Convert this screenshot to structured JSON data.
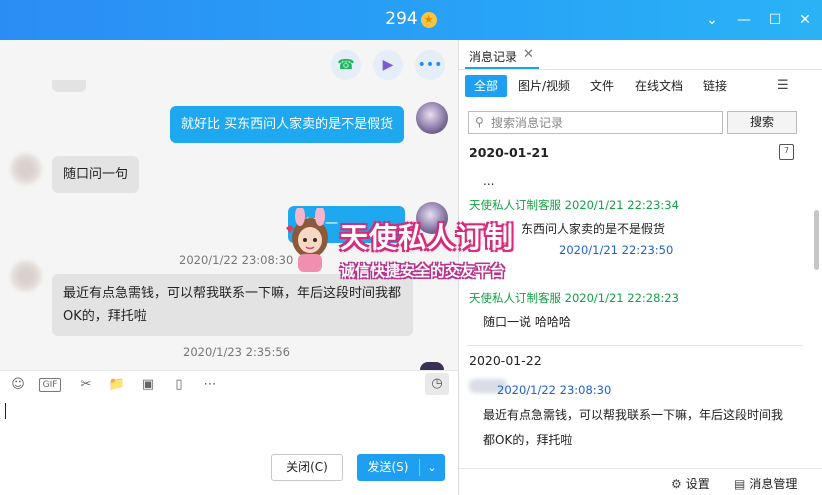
{
  "window": {
    "title": "294",
    "star_glyph": "★"
  },
  "chat": {
    "messages": [
      {
        "from": "me",
        "text": "就好比 买东西问人家卖的是不是假货"
      },
      {
        "from": "other",
        "text": "随口问一句"
      },
      {
        "from": "me",
        "text": "随口一"
      },
      {
        "timestamp": "2020/1/22 23:08:30"
      },
      {
        "from": "other",
        "lines": [
          "最近有点急需钱，可以帮我联系一下嘛，年后这段时间我都",
          "OK的，拜托啦"
        ]
      },
      {
        "timestamp": "2020/1/23 2:35:56"
      }
    ]
  },
  "composer": {
    "close_label": "关闭(C)",
    "send_label": "发送(S)"
  },
  "history": {
    "tab_label": "消息记录",
    "filters": [
      "全部",
      "图片/视频",
      "文件",
      "在线文档",
      "链接"
    ],
    "search_placeholder": "搜索消息记录",
    "search_button": "搜索",
    "groups": [
      {
        "date": "2020-01-21",
        "entries": [
          {
            "text": "..."
          },
          {
            "sender": "天使私人订制客服",
            "time": "2020/1/21 22:23:34",
            "text": "东西问人家卖的是不是假货"
          },
          {
            "time": "2020/1/21 22:23:50"
          },
          {
            "sender": "天使私人订制客服",
            "time": "2020/1/21 22:28:23",
            "text": "随口一说 哈哈哈"
          }
        ]
      },
      {
        "date": "2020-01-22",
        "entries": [
          {
            "time": "2020/1/22 23:08:30",
            "text": "最近有点急需钱，可以帮我联系一下嘛，年后这段时间我",
            "text2": "都OK的，拜托啦"
          }
        ]
      }
    ],
    "settings_label": "设置",
    "manage_label": "消息管理"
  },
  "watermark": {
    "title": "天使私人订制",
    "subtitle": "诚信快捷安全的交友平台"
  },
  "colors": {
    "accent": "#1e9ff2",
    "bubble_me": "#1ea8f0",
    "green_name": "#14a046",
    "blue_time": "#1e60d0"
  }
}
